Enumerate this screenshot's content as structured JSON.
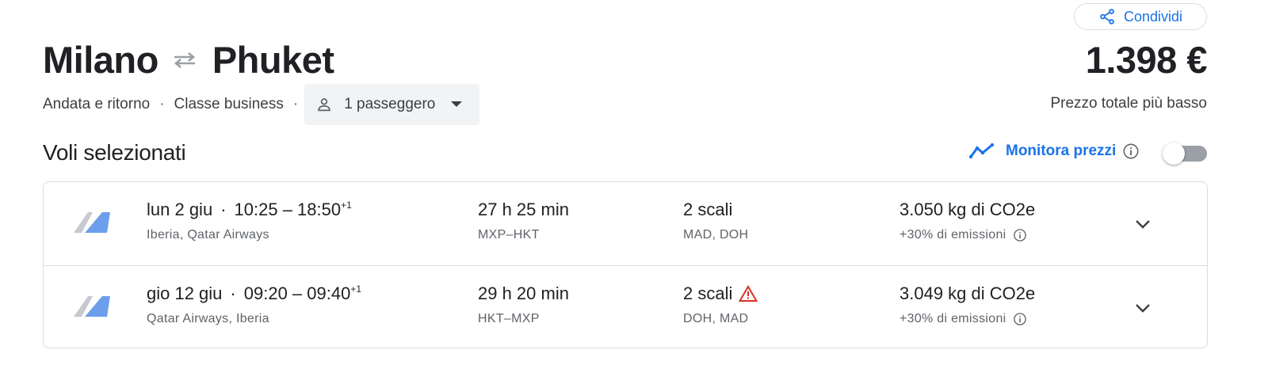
{
  "share_button": {
    "label": "Condividi",
    "icon": "share-icon"
  },
  "route": {
    "origin": "Milano",
    "destination": "Phuket",
    "icon": "swap-arrows-icon"
  },
  "price": {
    "value": "1.398 €",
    "caption": "Prezzo totale più basso"
  },
  "trip_options": {
    "trip_type": "Andata e ritorno",
    "cabin_class": "Classe business",
    "separator": "·",
    "passengers": "1 passeggero"
  },
  "section_title": "Voli selezionati",
  "track_prices": {
    "label": "Monitora prezzi",
    "enabled": false
  },
  "flights": [
    {
      "date": "lun 2 giu",
      "departure": "10:25",
      "arrival": "18:50",
      "day_offset": "+1",
      "airlines": "Iberia, Qatar Airways",
      "duration": "27 h 25 min",
      "route_codes": "MXP–HKT",
      "stops": "2 scali",
      "stop_airports": "MAD, DOH",
      "stops_warning": false,
      "emissions": "3.050 kg di CO2e",
      "emissions_delta": "+30% di emissioni"
    },
    {
      "date": "gio 12 giu",
      "departure": "09:20",
      "arrival": "09:40",
      "day_offset": "+1",
      "airlines": "Qatar Airways, Iberia",
      "duration": "29 h 20 min",
      "route_codes": "HKT–MXP",
      "stops": "2 scali",
      "stop_airports": "DOH, MAD",
      "stops_warning": true,
      "emissions": "3.049 kg di CO2e",
      "emissions_delta": "+30% di emissioni"
    }
  ],
  "colors": {
    "accent": "#1a73e8",
    "warning": "#d93025",
    "text": "#202124",
    "muted": "#5f6368",
    "border": "#dadce0"
  }
}
